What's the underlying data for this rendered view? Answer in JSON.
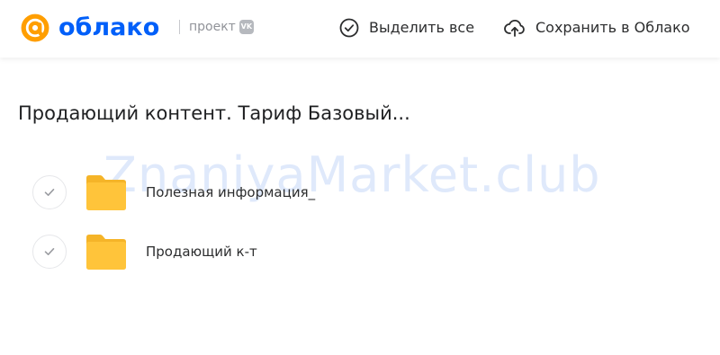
{
  "header": {
    "logo_text": "облако",
    "project_label": "проект",
    "project_badge": "VK",
    "select_all_label": "Выделить все",
    "save_label": "Сохранить в Облако"
  },
  "main": {
    "title": "Продающий контент. Тариф Базовый...",
    "files": [
      {
        "name": "Полезная информация_",
        "type": "folder"
      },
      {
        "name": "Продающий к-т",
        "type": "folder"
      }
    ]
  },
  "watermark": "ZnaniyaMarket.club",
  "colors": {
    "brand_blue": "#005ff9",
    "logo_orange": "#ff9e00",
    "folder_yellow": "#ffc43a"
  },
  "icons": {
    "logo": "mail-at-logo-icon",
    "select_all": "check-circle-icon",
    "save": "cloud-upload-icon",
    "row_check": "checkmark-icon",
    "file": "folder-icon"
  }
}
